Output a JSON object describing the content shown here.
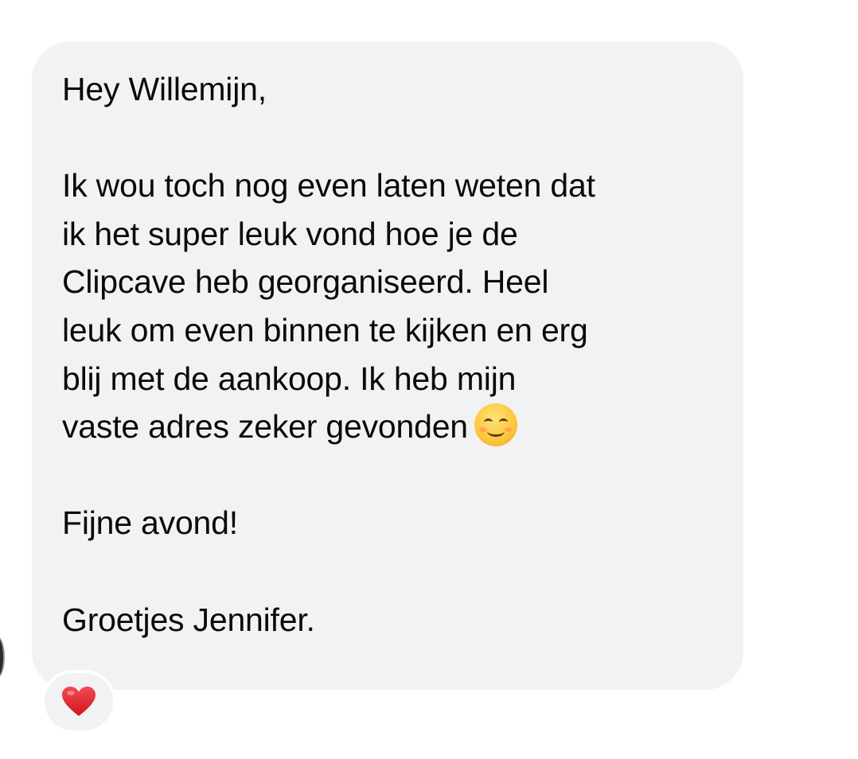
{
  "message": {
    "lines": [
      "Hey Willemijn,",
      "",
      "Ik wou toch nog even laten weten dat",
      "ik het super leuk vond hoe je de",
      "Clipcave heb georganiseerd. Heel",
      "leuk om even binnen te kijken en erg",
      "blij met de aankoop. Ik heb mijn",
      "vaste adres zeker gevonden",
      "",
      "Fijne avond!",
      "",
      "Groetjes Jennifer."
    ],
    "emoji": "smiling-face-icon",
    "bubble_color": "#f1f2f4",
    "text_color": "#0a0a0a"
  },
  "reaction": {
    "icon": "red-heart-icon",
    "color": "#e0222f"
  }
}
